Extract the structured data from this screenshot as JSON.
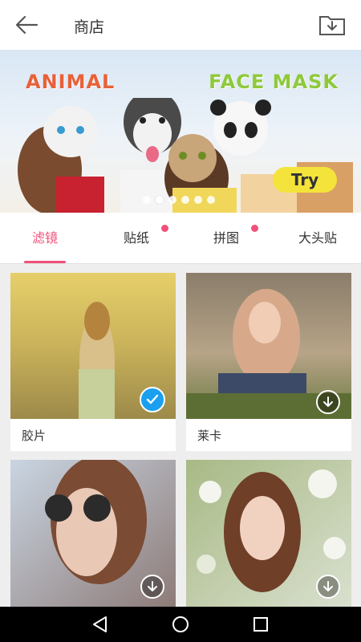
{
  "header": {
    "title": "商店"
  },
  "banner": {
    "title_word1": "ANIMAL",
    "title_word2": "FACE MASK",
    "try_label": "Try",
    "slide_count": 6,
    "active_slide": 1
  },
  "tabs": [
    {
      "label": "滤镜",
      "active": true,
      "badge": false
    },
    {
      "label": "贴纸",
      "active": false,
      "badge": true
    },
    {
      "label": "拼图",
      "active": false,
      "badge": true
    },
    {
      "label": "大头贴",
      "active": false,
      "badge": false
    }
  ],
  "filters": [
    {
      "label": "胶片",
      "state": "selected"
    },
    {
      "label": "莱卡",
      "state": "download"
    },
    {
      "label": "",
      "state": "download"
    },
    {
      "label": "",
      "state": "download"
    }
  ],
  "colors": {
    "accent": "#f0507a",
    "selected": "#1aa0ef"
  }
}
